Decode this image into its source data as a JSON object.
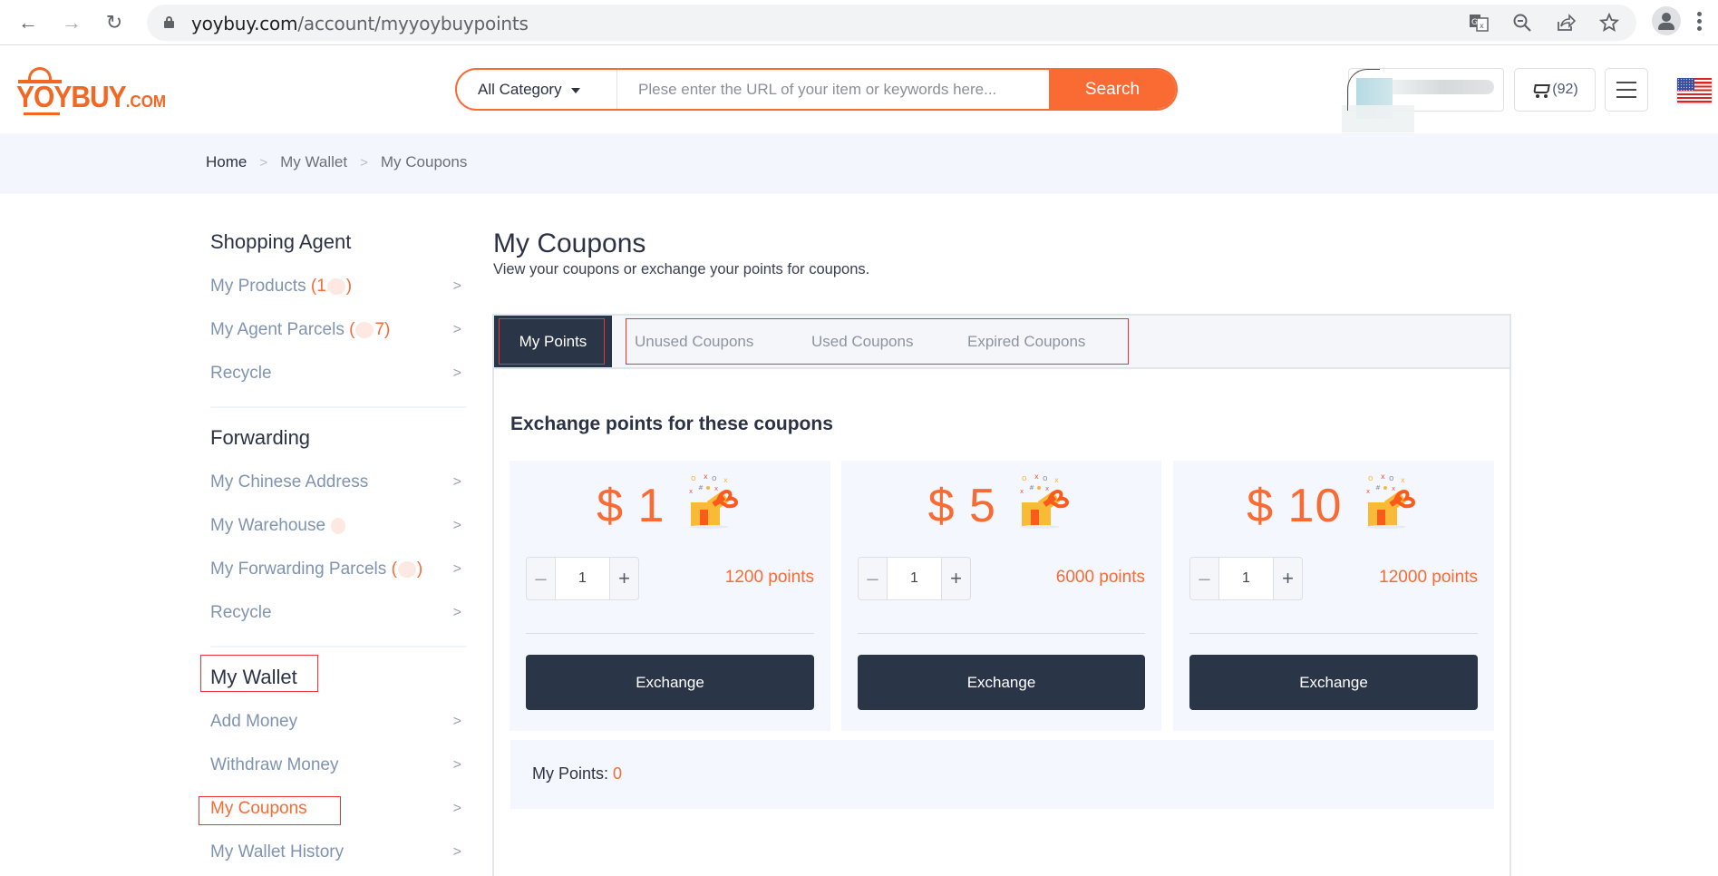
{
  "browser": {
    "url_host": "yoybuy.com",
    "url_path": "/account/myyoybuypoints",
    "icons": [
      "back-icon",
      "forward-icon",
      "reload-icon",
      "lock-icon",
      "translate-icon",
      "zoom-out-icon",
      "share-icon",
      "bookmark-star-icon",
      "profile-icon",
      "more-menu-icon"
    ]
  },
  "header": {
    "logo_main": "YOYBUY",
    "logo_suffix": ".COM",
    "search": {
      "category_label": "All Category",
      "placeholder": "Plese enter the URL of your item or keywords here...",
      "value": "",
      "button_label": "Search"
    },
    "cart_count": "(92)",
    "colors": {
      "accent": "#fa6a33",
      "dark": "#2b3548"
    }
  },
  "breadcrumb": {
    "items": [
      "Home",
      "My Wallet",
      "My Coupons"
    ]
  },
  "sidebar": {
    "sections": [
      {
        "heading": "Shopping Agent",
        "items": [
          {
            "label": "My Products",
            "count": "(1…)"
          },
          {
            "label": "My Agent Parcels",
            "count": "(…7)"
          },
          {
            "label": "Recycle",
            "count": ""
          }
        ]
      },
      {
        "heading": "Forwarding",
        "items": [
          {
            "label": "My Chinese Address",
            "count": ""
          },
          {
            "label": "My Warehouse",
            "count": "(…)"
          },
          {
            "label": "My Forwarding Parcels",
            "count": "(…)"
          },
          {
            "label": "Recycle",
            "count": ""
          }
        ]
      },
      {
        "heading": "My Wallet",
        "items": [
          {
            "label": "Add Money",
            "count": ""
          },
          {
            "label": "Withdraw Money",
            "count": ""
          },
          {
            "label": "My Coupons",
            "count": "",
            "active": true
          },
          {
            "label": "My Wallet History",
            "count": ""
          }
        ]
      }
    ]
  },
  "main": {
    "title": "My Coupons",
    "subtitle": "View your coupons or exchange your points for coupons.",
    "tabs": [
      {
        "label": "My Points",
        "active": true
      },
      {
        "label": "Unused Coupons"
      },
      {
        "label": "Used Coupons"
      },
      {
        "label": "Expired Coupons"
      }
    ],
    "section_title": "Exchange points for these coupons",
    "coupons": [
      {
        "amount": "$ 1",
        "quantity": "1",
        "points": "1200 points",
        "button": "Exchange"
      },
      {
        "amount": "$ 5",
        "quantity": "1",
        "points": "6000 points",
        "button": "Exchange"
      },
      {
        "amount": "$ 10",
        "quantity": "1",
        "points": "12000 points",
        "button": "Exchange"
      }
    ],
    "my_points_label": "My Points: ",
    "my_points_value": "0"
  }
}
